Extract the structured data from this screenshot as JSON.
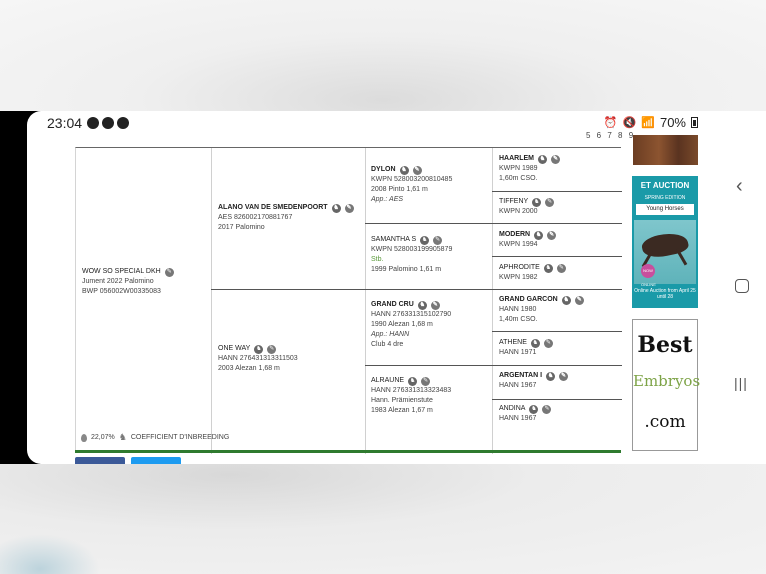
{
  "status_bar": {
    "time": "23:04",
    "battery": "70%"
  },
  "page_indicator": "5 6 7 8 9",
  "pedigree": {
    "subject": {
      "name": "WOW SO SPECIAL DKH",
      "line1": "Jument 2022 Palomino",
      "line2": "BWP 056002W00335083"
    },
    "sire": {
      "name": "ALANO VAN DE SMEDENPOORT",
      "line1": "AES 826002170881767",
      "line2": "2017 Palomino"
    },
    "dam": {
      "name": "ONE WAY",
      "line1": "HANN 276431313311503",
      "line2": "2003 Alezan 1,68 m"
    },
    "ss": {
      "name": "DYLON",
      "line1": "KWPN 528003200810485",
      "line2": "2008 Pinto 1,61 m",
      "line3": "App.: AES"
    },
    "sd": {
      "name": "SAMANTHA S",
      "line1": "KWPN 528003199905879",
      "line2": "Stb.",
      "line3": "1999 Palomino 1,61 m"
    },
    "ds": {
      "name": "GRAND CRU",
      "line1": "HANN 276331315102790",
      "line2": "1990 Alezan 1,68 m",
      "line3": "App.: HANN",
      "line4": "Club 4 dre"
    },
    "dd": {
      "name": "ALRAUNE",
      "line1": "HANN 276331313323483",
      "line2": "Hann. Prämienstute",
      "line3": "1983 Alezan 1,67 m"
    },
    "sss": {
      "name": "HAARLEM",
      "line1": "KWPN 1989",
      "line2": "1,60m CSO."
    },
    "ssd": {
      "name": "TIFFENY",
      "line1": "KWPN 2000"
    },
    "sds": {
      "name": "MODERN",
      "line1": "KWPN 1994"
    },
    "sdd": {
      "name": "APHRODITE",
      "line1": "KWPN 1982"
    },
    "dss": {
      "name": "GRAND GARCON",
      "line1": "HANN 1980",
      "line2": "1,40m CSO."
    },
    "dsd": {
      "name": "ATHENE",
      "line1": "HANN 1971"
    },
    "dds": {
      "name": "ARGENTAN I",
      "line1": "HANN 1967"
    },
    "ddd": {
      "name": "ANDINA",
      "line1": "HANN 1967"
    }
  },
  "inbreeding": {
    "value": "22,07%",
    "label": "COEFFICIENT D'INBREEDING"
  },
  "ads": {
    "et": {
      "title": "ET AUCTION",
      "edition": "SPRING EDITION",
      "young": "Young Horses",
      "badge": "NOW ONLINE",
      "online": "Online Auction from April 25 until 28"
    },
    "best": {
      "line1": "Best",
      "line2": "Embryos",
      "line3": ".com"
    }
  }
}
